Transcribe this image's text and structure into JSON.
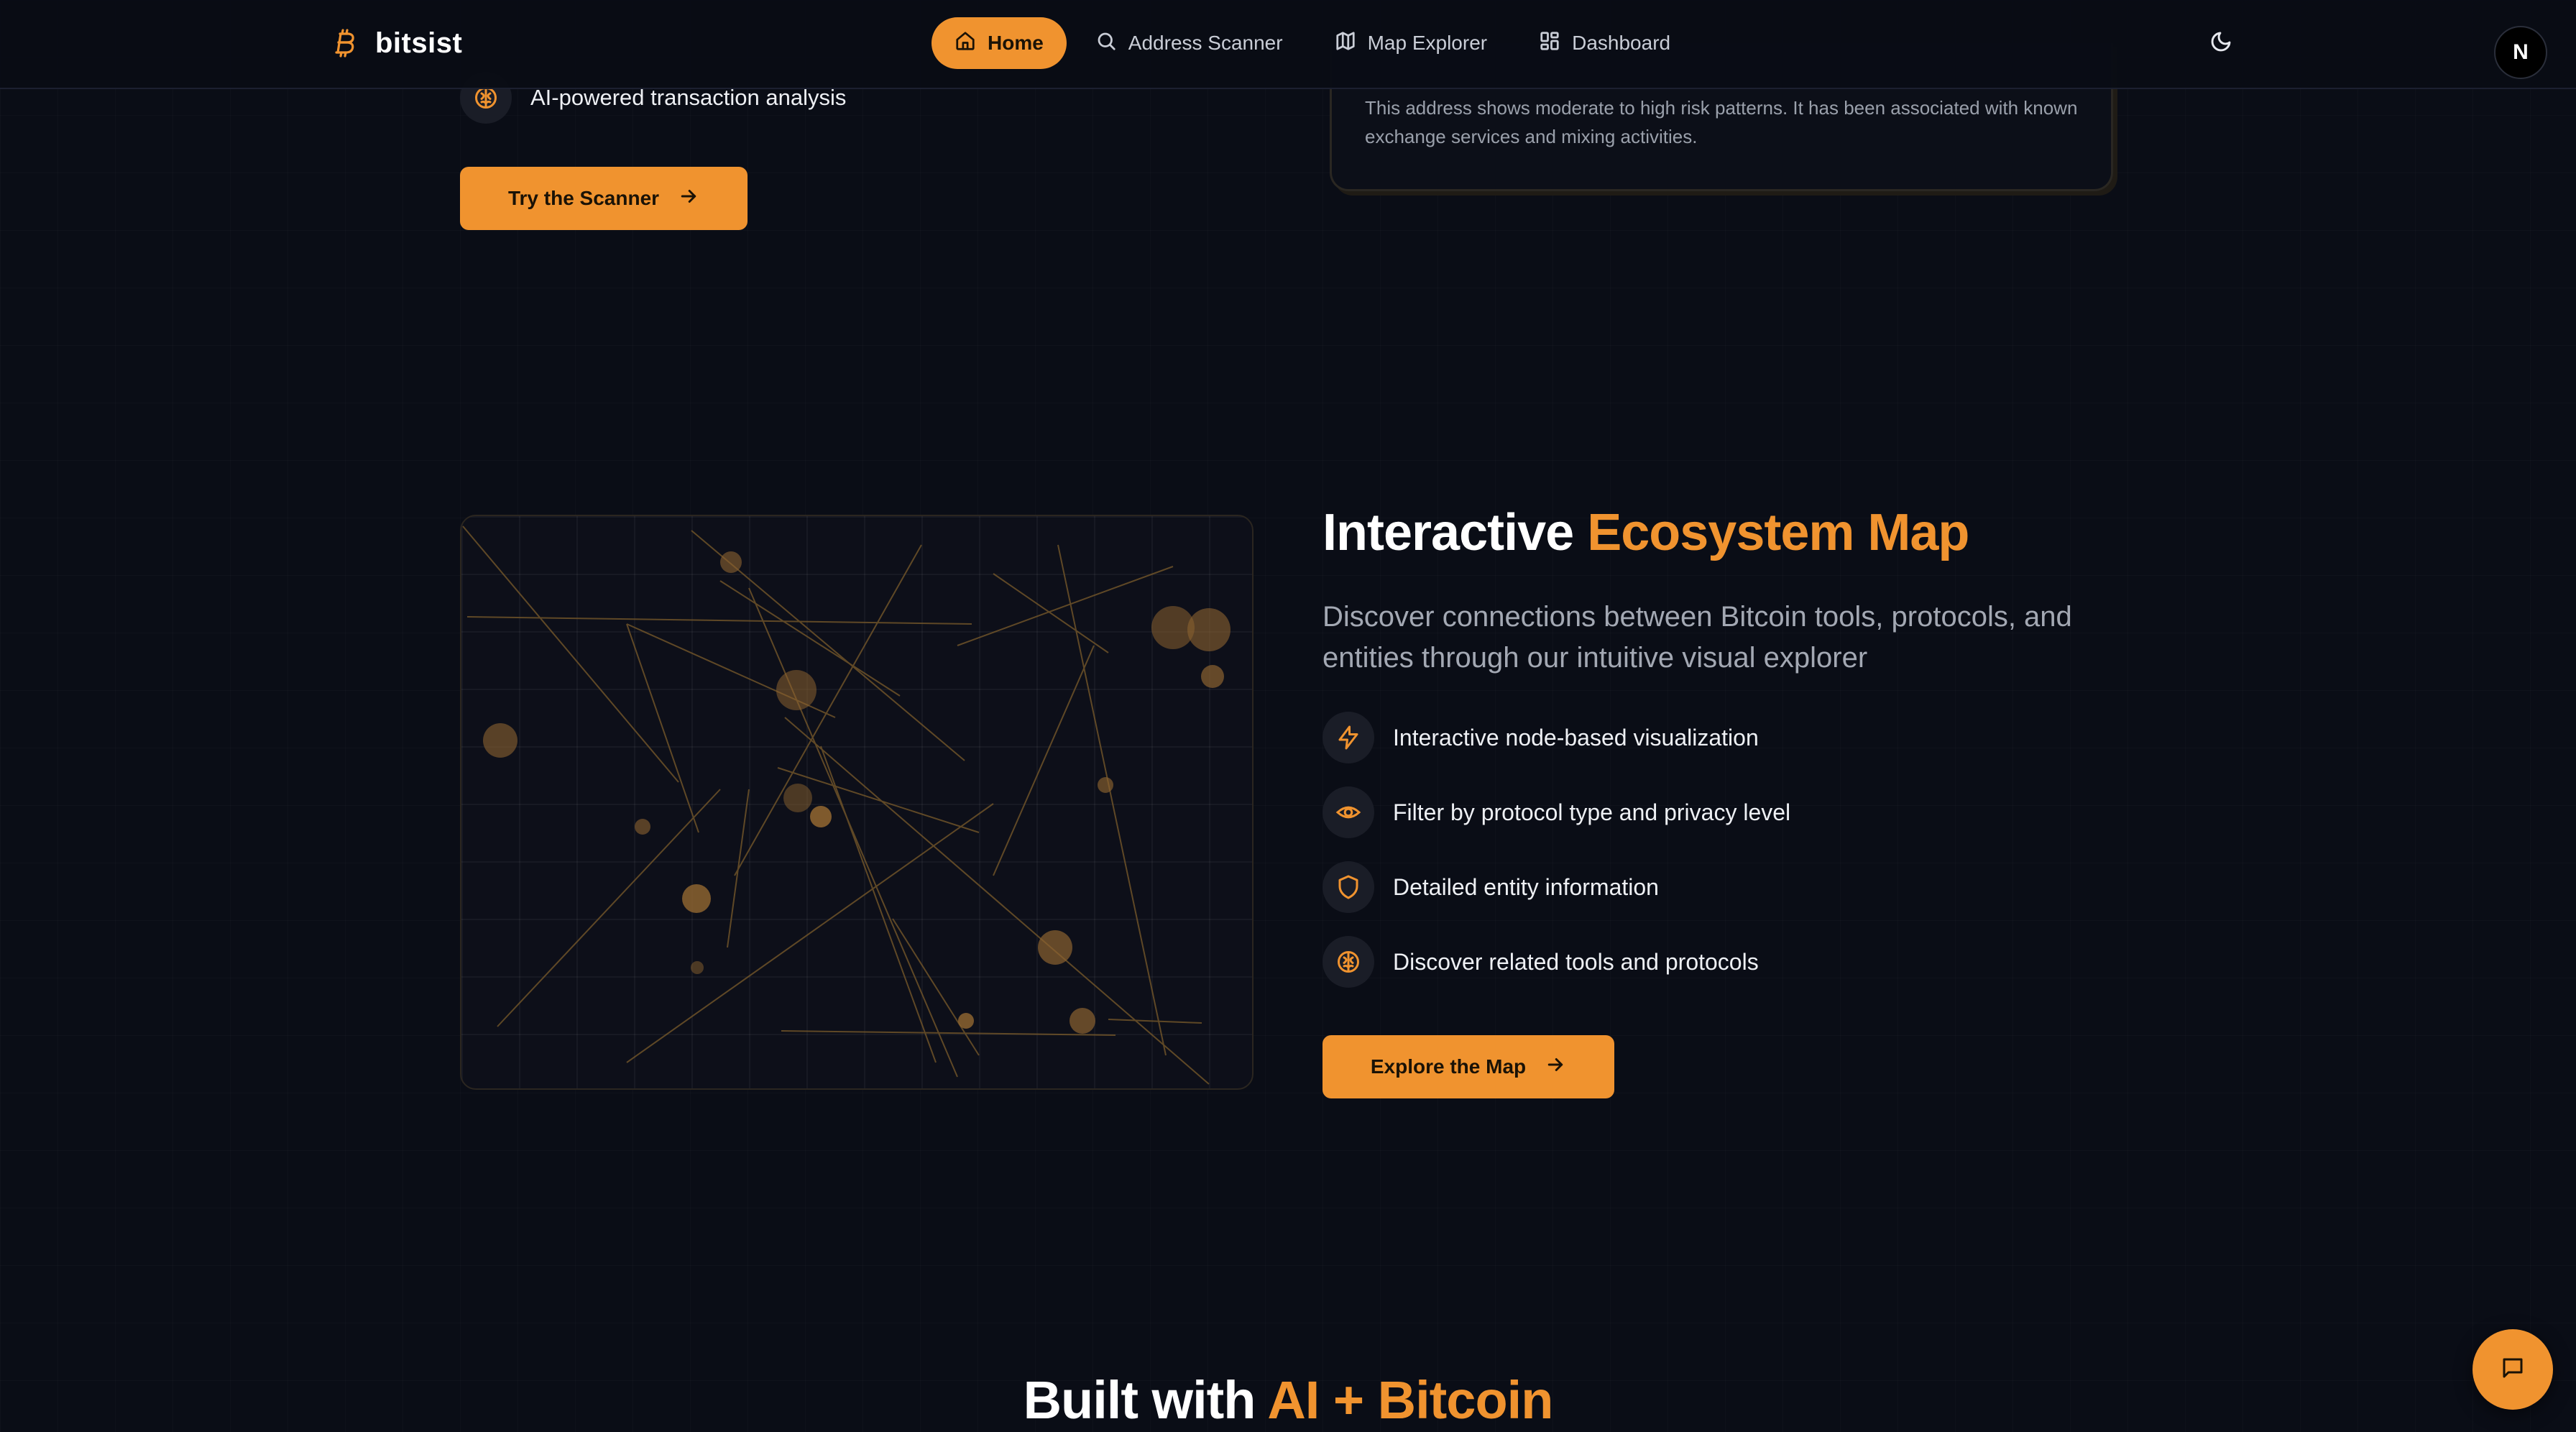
{
  "brand": {
    "name": "bitsist",
    "icon": "bitcoin-icon",
    "accent_color": "#f0932f"
  },
  "nav": {
    "items": [
      {
        "label": "Home",
        "icon": "home-icon",
        "active": true
      },
      {
        "label": "Address Scanner",
        "icon": "search-icon",
        "active": false
      },
      {
        "label": "Map Explorer",
        "icon": "map-icon",
        "active": false
      },
      {
        "label": "Dashboard",
        "icon": "dashboard-icon",
        "active": false
      }
    ],
    "theme_icon": "moon-icon",
    "avatar_letter": "N"
  },
  "scanner": {
    "feature_text": "AI-powered transaction analysis",
    "feature_icon": "brain-icon",
    "button_label": "Try the Scanner",
    "risk_text": "This address shows moderate to high risk patterns. It has been associated with known exchange services and mixing activities."
  },
  "ecosystem": {
    "title_main": "Interactive ",
    "title_accent": "Ecosystem Map",
    "description": "Discover connections between Bitcoin tools, protocols, and entities through our intuitive visual explorer",
    "features": [
      {
        "icon": "zap-icon",
        "text": "Interactive node-based visualization"
      },
      {
        "icon": "eye-icon",
        "text": "Filter by protocol type and privacy level"
      },
      {
        "icon": "shield-icon",
        "text": "Detailed entity information"
      },
      {
        "icon": "brain-icon",
        "text": "Discover related tools and protocols"
      }
    ],
    "button_label": "Explore the Map"
  },
  "built": {
    "title_main": "Built with ",
    "title_accent": "AI + Bitcoin"
  },
  "chat": {
    "icon": "chat-icon"
  }
}
